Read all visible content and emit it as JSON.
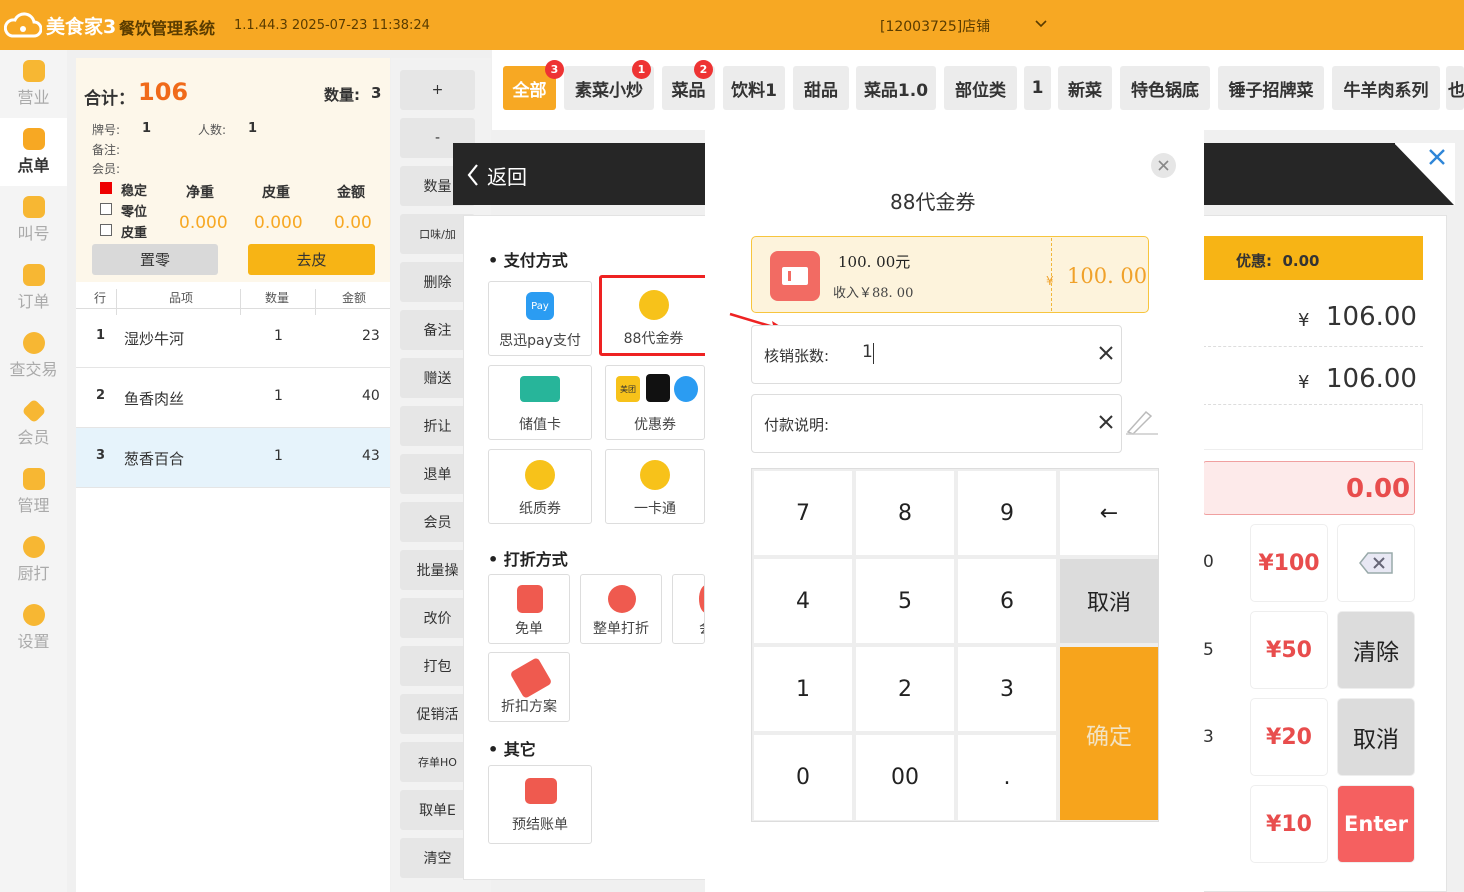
{
  "topbar": {
    "brand": "美食家3",
    "system_title": "餐饮管理系统",
    "version": "1.1.44.3 2025-07-23 11:38:24",
    "store": "[12003725]店铺"
  },
  "nav": [
    {
      "label": "营业",
      "icon": "chart-icon"
    },
    {
      "label": "点单",
      "icon": "hand-icon"
    },
    {
      "label": "叫号",
      "icon": "number-icon"
    },
    {
      "label": "订单",
      "icon": "list-icon"
    },
    {
      "label": "查交易",
      "icon": "search-icon"
    },
    {
      "label": "会员",
      "icon": "diamond-icon"
    },
    {
      "label": "管理",
      "icon": "manage-icon"
    },
    {
      "label": "厨打",
      "icon": "kitchen-icon"
    },
    {
      "label": "设置",
      "icon": "gear-icon"
    }
  ],
  "order": {
    "total_label": "合计：",
    "total_value": "106",
    "qty_label": "数量:",
    "qty_value": "3",
    "table_label": "牌号:",
    "table_value": "1",
    "people_label": "人数:",
    "people_value": "1",
    "note_label": "备注:",
    "member_label": "会员:",
    "checks": [
      {
        "label": "稳定",
        "checked": true
      },
      {
        "label": "零位",
        "checked": false
      },
      {
        "label": "皮重",
        "checked": false
      }
    ],
    "weight_headers": [
      "净重",
      "皮重",
      "金额"
    ],
    "weight_values": [
      "0.000",
      "0.000",
      "0.00"
    ],
    "zero_button": "置零",
    "tare_button": "去皮",
    "columns": [
      "行",
      "品项",
      "数量",
      "金额"
    ],
    "rows": [
      {
        "no": "1",
        "name": "湿炒牛河",
        "qty": "1",
        "amount": "23"
      },
      {
        "no": "2",
        "name": "鱼香肉丝",
        "qty": "1",
        "amount": "40"
      },
      {
        "no": "3",
        "name": "葱香百合",
        "qty": "1",
        "amount": "43"
      }
    ]
  },
  "actions": [
    "+",
    "-",
    "数量",
    "口味/加",
    "删除",
    "备注",
    "赠送",
    "折让",
    "退单",
    "会员",
    "批量操",
    "改价",
    "打包",
    "促销活",
    "存单HO",
    "取单E",
    "清空"
  ],
  "categories": [
    {
      "label": "全部",
      "badge": "3",
      "active": true
    },
    {
      "label": "素菜小炒",
      "badge": "1",
      "active": false
    },
    {
      "label": "菜品",
      "badge": "2",
      "active": false
    },
    {
      "label": "饮料1",
      "badge": "",
      "active": false
    },
    {
      "label": "甜品",
      "badge": "",
      "active": false
    },
    {
      "label": "菜品1.0",
      "badge": "",
      "active": false
    },
    {
      "label": "部位类",
      "badge": "",
      "active": false
    },
    {
      "label": "1",
      "badge": "",
      "active": false
    },
    {
      "label": "新菜",
      "badge": "",
      "active": false
    },
    {
      "label": "特色锅底",
      "badge": "",
      "active": false
    },
    {
      "label": "锤子招牌菜",
      "badge": "",
      "active": false
    },
    {
      "label": "牛羊肉系列",
      "badge": "",
      "active": false
    },
    {
      "label": "也",
      "badge": "",
      "active": false
    }
  ],
  "payment": {
    "back_label": "返回",
    "pay_section": "支付方式",
    "methods": [
      {
        "label": "思迅pay支付",
        "icon": "pay-icon",
        "highlighted": false
      },
      {
        "label": "88代金券",
        "icon": "voucher-icon",
        "highlighted": true
      },
      {
        "label": "储值卡",
        "icon": "card-icon",
        "highlighted": false
      },
      {
        "label": "优惠券",
        "icon": "coupon-icon",
        "highlighted": false
      },
      {
        "label": "纸质券",
        "icon": "paper-voucher-icon",
        "highlighted": false
      },
      {
        "label": "一卡通",
        "icon": "one-card-icon",
        "highlighted": false
      }
    ],
    "coupon_tags": [
      "美团"
    ],
    "discount_section": "打折方式",
    "discounts": [
      {
        "label": "免单",
        "icon": "free-icon"
      },
      {
        "label": "整单打折",
        "icon": "percent-icon"
      },
      {
        "label": "会",
        "icon": "member-icon"
      },
      {
        "label": "折扣方案",
        "icon": "tag-icon"
      }
    ],
    "other_section": "其它",
    "others": [
      {
        "label": "预结账单",
        "icon": "wallet-icon"
      }
    ],
    "discount_label": "优惠:",
    "discount_value": "0.00",
    "currency": "¥",
    "amount_due": "106.00",
    "amount_received": "106.00",
    "remaining": "0.00",
    "quick_amounts": [
      "¥100",
      "¥50",
      "¥20",
      "¥10"
    ],
    "partial_quick_digits": [
      "0",
      "5",
      "3"
    ],
    "quick_actions": {
      "clear": "清除",
      "cancel": "取消",
      "enter": "Enter"
    }
  },
  "modal": {
    "title": "88代金券",
    "ticket_amount": "100. 00元",
    "ticket_income": "收入￥88. 00",
    "ticket_currency": "¥",
    "ticket_value": "100. 00",
    "count_label": "核销张数:",
    "count_value": "1",
    "note_label": "付款说明:",
    "note_value": "",
    "keys": [
      "7",
      "8",
      "9",
      "←",
      "4",
      "5",
      "6",
      "取消",
      "1",
      "2",
      "3",
      "确定",
      "0",
      "00",
      "."
    ]
  },
  "colors": {
    "brand": "#f7a823",
    "accent_red": "#e84d4d",
    "highlight": "#e22222",
    "confirm": "#f7a41c"
  }
}
